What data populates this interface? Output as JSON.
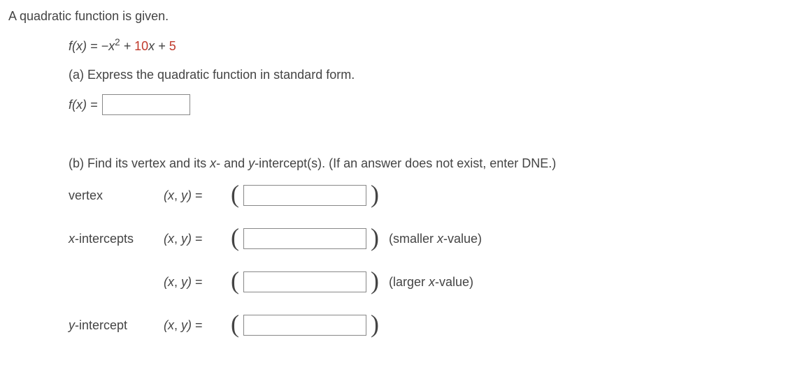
{
  "intro": "A quadratic function is given.",
  "formula": {
    "lhs": "f(x)",
    "eq": "=",
    "neg": "−",
    "x": "x",
    "sq": "2",
    "plus1": "+",
    "coef": "10",
    "x2": "x",
    "plus2": "+",
    "const": "5"
  },
  "partA": {
    "prompt": "(a) Express the quadratic function in standard form.",
    "lhs": "f(x) ="
  },
  "partB": {
    "prompt": "(b) Find its vertex and its x- and y-intercept(s). (If an answer does not exist, enter DNE.)",
    "rows": {
      "vertex": {
        "label": "vertex",
        "xy": "(x, y) ="
      },
      "xint1": {
        "label": "x-intercepts",
        "xy": "(x, y) =",
        "hint": "(smaller x-value)"
      },
      "xint2": {
        "label": "",
        "xy": "(x, y) =",
        "hint": "(larger x-value)"
      },
      "yint": {
        "label": "y-intercept",
        "xy": "(x, y) ="
      }
    }
  }
}
